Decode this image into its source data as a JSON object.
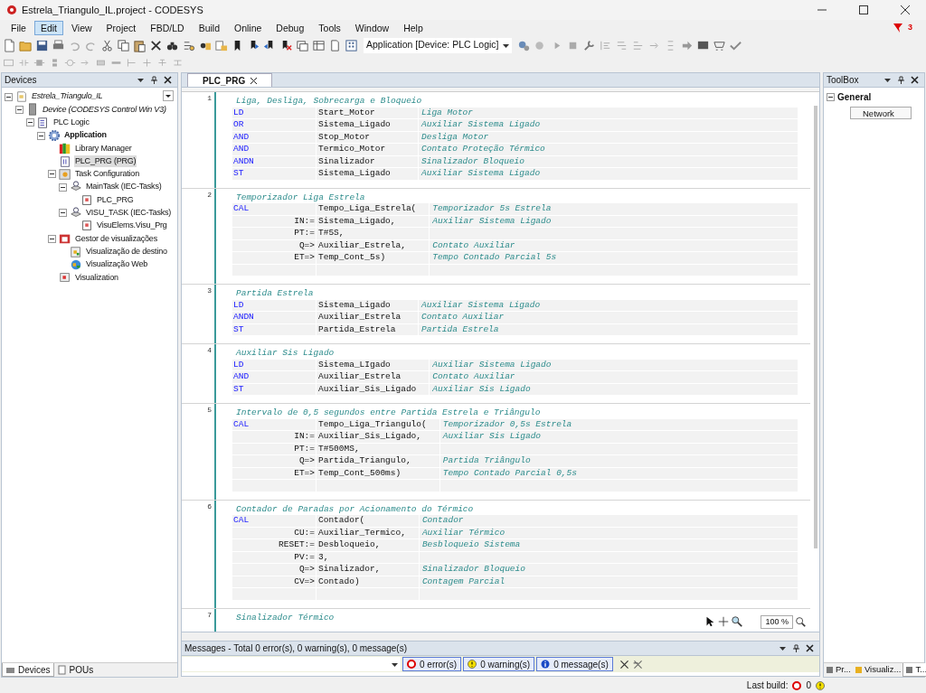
{
  "window": {
    "title": "Estrela_Triangulo_IL.project - CODESYS"
  },
  "menu": [
    {
      "label": "File",
      "selected": false
    },
    {
      "label": "Edit",
      "selected": true
    },
    {
      "label": "View",
      "selected": false
    },
    {
      "label": "Project",
      "selected": false
    },
    {
      "label": "FBD/LD",
      "selected": false
    },
    {
      "label": "Build",
      "selected": false
    },
    {
      "label": "Online",
      "selected": false
    },
    {
      "label": "Debug",
      "selected": false
    },
    {
      "label": "Tools",
      "selected": false
    },
    {
      "label": "Window",
      "selected": false
    },
    {
      "label": "Help",
      "selected": false
    }
  ],
  "notification_count": "3",
  "application_selector": "Application [Device: PLC Logic]",
  "devices_panel": {
    "title": "Devices",
    "tree": [
      {
        "label": "Estrela_Triangulo_IL",
        "kind": "project",
        "expanded": true,
        "selected": false,
        "children": [
          {
            "label": "Device (CODESYS Control Win V3)",
            "kind": "device",
            "expanded": true,
            "selected": false,
            "children": [
              {
                "label": "PLC Logic",
                "kind": "plc",
                "expanded": true,
                "selected": false,
                "children": [
                  {
                    "label": "Application",
                    "kind": "application",
                    "expanded": true,
                    "selected": false,
                    "children": [
                      {
                        "label": "Library Manager",
                        "kind": "library",
                        "selected": false
                      },
                      {
                        "label": "PLC_PRG (PRG)",
                        "kind": "pou",
                        "selected": true
                      },
                      {
                        "label": "Task Configuration",
                        "kind": "taskconfig",
                        "expanded": true,
                        "selected": false,
                        "children": [
                          {
                            "label": "MainTask (IEC-Tasks)",
                            "kind": "task",
                            "expanded": true,
                            "selected": false,
                            "children": [
                              {
                                "label": "PLC_PRG",
                                "kind": "call",
                                "selected": false
                              }
                            ]
                          },
                          {
                            "label": "VISU_TASK (IEC-Tasks)",
                            "kind": "task",
                            "expanded": true,
                            "selected": false,
                            "children": [
                              {
                                "label": "VisuElems.Visu_Prg",
                                "kind": "call",
                                "selected": false
                              }
                            ]
                          }
                        ]
                      },
                      {
                        "label": "Gestor de visualizações",
                        "kind": "visumanager",
                        "expanded": true,
                        "selected": false,
                        "children": [
                          {
                            "label": "Visualização de destino",
                            "kind": "visutarget",
                            "selected": false
                          },
                          {
                            "label": "Visualização Web",
                            "kind": "visuweb",
                            "selected": false
                          }
                        ]
                      },
                      {
                        "label": "Visualization",
                        "kind": "visu",
                        "selected": false
                      }
                    ]
                  }
                ]
              }
            ]
          }
        ]
      }
    ],
    "tabs": [
      {
        "label": "Devices",
        "selected": true
      },
      {
        "label": "POUs",
        "selected": false
      }
    ]
  },
  "editor": {
    "tab": "PLC_PRG",
    "networks": [
      {
        "number": "1",
        "comment": "Liga, Desliga, Sobrecarga e Bloqueio",
        "rows": [
          {
            "kind": "instr",
            "op": "LD",
            "operand": "Start_Motor",
            "note": "Liga Motor"
          },
          {
            "kind": "instr",
            "op": "OR",
            "operand": "Sistema_Ligado",
            "note": "Auxiliar Sistema Ligado"
          },
          {
            "kind": "instr",
            "op": "AND",
            "operand": "Stop_Motor",
            "note": "Desliga Motor"
          },
          {
            "kind": "instr",
            "op": "AND",
            "operand": "Termico_Motor",
            "note": "Contato Proteção Térmico"
          },
          {
            "kind": "instr",
            "op": "ANDN",
            "operand": "Sinalizador",
            "note": "Sinalizador Bloqueio"
          },
          {
            "kind": "instr",
            "op": "ST",
            "operand": "Sistema_Ligado",
            "note": "Auxiliar Sistema Ligado"
          }
        ]
      },
      {
        "number": "2",
        "comment": "Temporizador Liga Estrela",
        "rows": [
          {
            "kind": "instr",
            "op": "CAL",
            "operand": "Tempo_Liga_Estrela(",
            "note": "Temporizador 5s Estrela"
          },
          {
            "kind": "param",
            "op": "IN:=",
            "operand": "Sistema_Ligado,",
            "note": "Auxiliar Sistema Ligado"
          },
          {
            "kind": "param",
            "op": "PT:=",
            "operand": "T#5S,"
          },
          {
            "kind": "param",
            "op": "Q=>",
            "operand": "Auxiliar_Estrela,",
            "note": "Contato Auxiliar"
          },
          {
            "kind": "param",
            "op": "ET=>",
            "operand": "Temp_Cont_5s)",
            "note": "Tempo Contado Parcial 5s"
          },
          {
            "kind": "blank"
          }
        ]
      },
      {
        "number": "3",
        "comment": "Partida Estrela",
        "rows": [
          {
            "kind": "instr",
            "op": "LD",
            "operand": "Sistema_Ligado",
            "note": "Auxiliar Sistema Ligado"
          },
          {
            "kind": "instr",
            "op": "ANDN",
            "operand": "Auxiliar_Estrela",
            "note": "Contato Auxiliar"
          },
          {
            "kind": "instr",
            "op": "ST",
            "operand": "Partida_Estrela",
            "note": "Partida Estrela"
          }
        ]
      },
      {
        "number": "4",
        "comment": "Auxiliar Sis Ligado",
        "rows": [
          {
            "kind": "instr",
            "op": "LD",
            "operand": "Sistema_LIgado",
            "note": "Auxiliar Sistema Ligado"
          },
          {
            "kind": "instr",
            "op": "AND",
            "operand": "Auxiliar_Estrela",
            "note": "Contato Auxiliar"
          },
          {
            "kind": "instr",
            "op": "ST",
            "operand": "Auxiliar_Sis_Ligado",
            "note": "Auxiliar Sis Ligado"
          }
        ]
      },
      {
        "number": "5",
        "comment": "Intervalo de 0,5 segundos entre Partida Estrela e Triângulo",
        "rows": [
          {
            "kind": "instr",
            "op": "CAL",
            "operand": "Tempo_Liga_Triangulo(",
            "note": "Temporizador 0,5s Estrela"
          },
          {
            "kind": "param",
            "op": "IN:=",
            "operand": "Auxiliar_Sis_Ligado,",
            "note": "Auxiliar Sis Ligado"
          },
          {
            "kind": "param",
            "op": "PT:=",
            "operand": "T#500MS,"
          },
          {
            "kind": "param",
            "op": "Q=>",
            "operand": "Partida_Triangulo,",
            "note": "Partida Triângulo"
          },
          {
            "kind": "param",
            "op": "ET=>",
            "operand": "Temp_Cont_500ms)",
            "note": "Tempo Contado Parcial 0,5s"
          },
          {
            "kind": "blank"
          }
        ]
      },
      {
        "number": "6",
        "comment": "Contador de Paradas por Acionamento do Térmico",
        "rows": [
          {
            "kind": "instr",
            "op": "CAL",
            "operand": "Contador(",
            "note": "Contador"
          },
          {
            "kind": "param",
            "op": "CU:=",
            "operand": "Auxiliar_Termico,",
            "note": "Auxiliar Térmico"
          },
          {
            "kind": "param",
            "op": "RESET:=",
            "operand": "Desbloqueio,",
            "note": "Besbloqueio Sistema"
          },
          {
            "kind": "param",
            "op": "PV:=",
            "operand": "3,"
          },
          {
            "kind": "param",
            "op": "Q=>",
            "operand": "Sinalizador,",
            "note": "Sinalizador Bloqueio"
          },
          {
            "kind": "param",
            "op": "CV=>",
            "operand": "Contado)",
            "note": "Contagem Parcial"
          },
          {
            "kind": "blank"
          }
        ]
      },
      {
        "number": "7",
        "comment": "Sinalizador Térmico"
      }
    ],
    "zoom": "100 %"
  },
  "messages": {
    "title": "Messages - Total 0 error(s), 0 warning(s), 0 message(s)",
    "filters": [
      {
        "kind": "error",
        "label": "0 error(s)",
        "selected": true
      },
      {
        "kind": "warning",
        "label": "0 warning(s)",
        "selected": true
      },
      {
        "kind": "info",
        "label": "0 message(s)",
        "selected": true
      }
    ]
  },
  "toolbox": {
    "title": "ToolBox",
    "group": "General",
    "items": [
      "Network"
    ],
    "tabs": [
      {
        "label": "Pr...",
        "selected": false
      },
      {
        "label": "Visualiz...",
        "selected": false
      },
      {
        "label": "T...",
        "selected": true
      }
    ]
  },
  "status_bar": {
    "label": "Last build:",
    "errors": "0"
  }
}
